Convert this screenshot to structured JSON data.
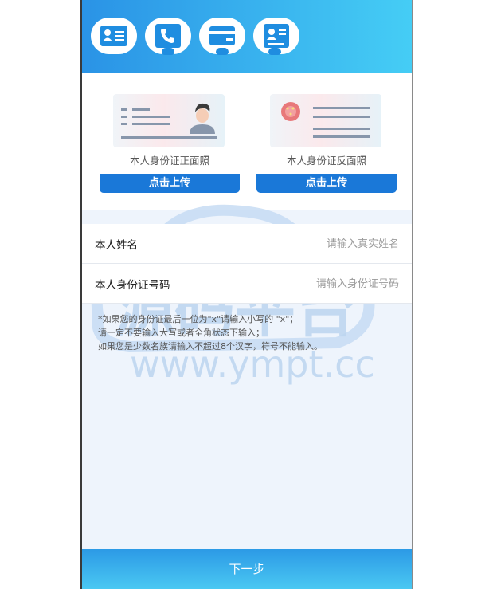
{
  "steps": [
    {
      "icon": "id-card-icon"
    },
    {
      "icon": "phone-icon"
    },
    {
      "icon": "bank-card-icon"
    },
    {
      "icon": "id-photo-icon"
    }
  ],
  "upload": {
    "front_caption": "本人身份证正面照",
    "back_caption": "本人身份证反面照",
    "button_label": "点击上传"
  },
  "form": {
    "name_label": "本人姓名",
    "name_placeholder": "请输入真实姓名",
    "id_label": "本人身份证号码",
    "id_placeholder": "请输入身份证号码"
  },
  "notes": [
    "*如果您的身份证最后一位为\"x\"请输入小写的 \"x\"；",
    "请一定不要输入大写或者全角状态下输入；",
    "如果您是少数名族请输入不超过8个汉字，符号不能输入。"
  ],
  "watermark": {
    "title": "源码平台",
    "url": "www.ympt.cc"
  },
  "footer": {
    "next_label": "下一步"
  },
  "colors": {
    "primary": "#1a78d8",
    "header_start": "#2a93e6",
    "header_end": "#45cdf5"
  }
}
